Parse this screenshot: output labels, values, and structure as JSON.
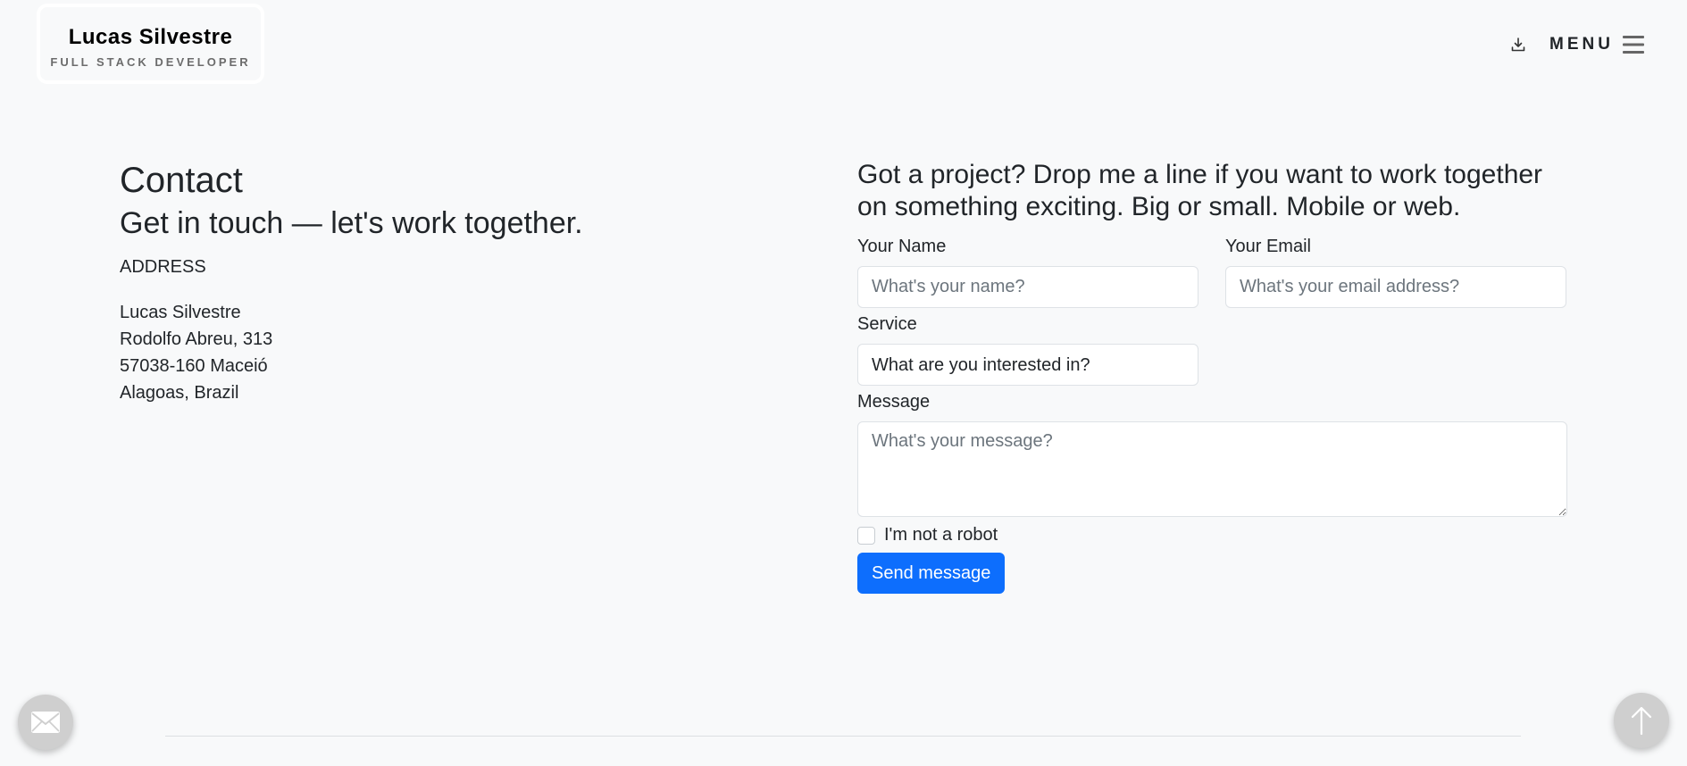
{
  "header": {
    "logo_name": "Lucas Silvestre",
    "logo_role": "FULL STACK DEVELOPER",
    "download_icon": "download-icon",
    "menu_label": "MENU",
    "menu_icon": "hamburger-icon"
  },
  "contact": {
    "title": "Contact",
    "subtitle": "Get in touch — let's work together.",
    "address_heading": "ADDRESS",
    "address_lines": [
      "Lucas Silvestre",
      "Rodolfo Abreu, 313",
      "57038-160 Maceió",
      "Alagoas, Brazil"
    ]
  },
  "form": {
    "pitch": "Got a project? Drop me a line if you want to work together on something exciting. Big or small. Mobile or web.",
    "name_label": "Your Name",
    "name_placeholder": "What's your name?",
    "email_label": "Your Email",
    "email_placeholder": "What's your email address?",
    "service_label": "Service",
    "service_selected": "What are you interested in?",
    "message_label": "Message",
    "message_placeholder": "What's your message?",
    "robot_label": "I'm not a robot",
    "submit_label": "Send message"
  },
  "floating": {
    "mail_icon": "mail-icon",
    "top_icon": "arrow-up-icon"
  },
  "colors": {
    "background": "#f8f9fa",
    "primary": "#0d6efd",
    "fab": "#cfcfcf"
  }
}
